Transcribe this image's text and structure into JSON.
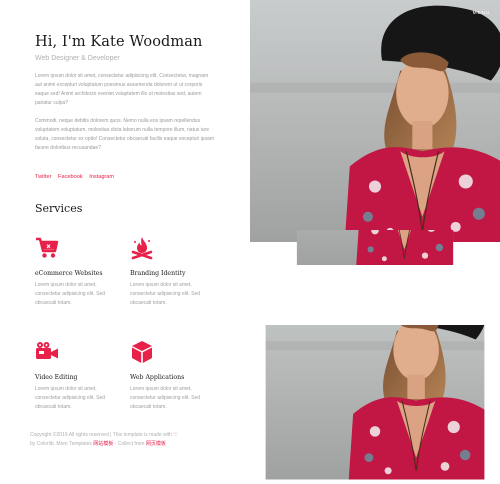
{
  "hero": {
    "title": "Hi, I'm Kate Woodman",
    "subtitle": "Web Designer & Developer"
  },
  "about": {
    "paragraph1": "Lorem ipsum dolor sit amet, consectetur adipisicing elit. Consectetur, magnam aut animi excepturi voluptatum possimus assumenda dolorem ut ut corporis eaque sed! Animi architecto eveniet voluptatem illo ut molestias sed, autem pariatur culpa?",
    "paragraph2": "Commodi, neque debitis dolorem quos. Nemo nulla eos ipsam repellendus voluptatem voluptatum, molestiae dicta laborum nulla tempore illum, natus iure soluta, consectetur ex optio! Consectetur obcaecati facilis eaque excepturi ipsam facere doloribus recusandae?"
  },
  "social": [
    "Twitter",
    "Facebook",
    "Instagram"
  ],
  "services": {
    "title": "Services",
    "items": [
      {
        "name": "eCommerce Websites",
        "description": "Lorem ipsum dolor sit amet, consectetur adipisicing elit. Sed obcaecati totam.",
        "icon": "cart-icon"
      },
      {
        "name": "Branding Identity",
        "description": "Lorem ipsum dolor sit amet, consectetur adipisicing elit. Sed obcaecati totam.",
        "icon": "fire-icon"
      },
      {
        "name": "Video Editing",
        "description": "Lorem ipsum dolor sit amet, consectetur adipisicing elit. Sed obcaecati totam.",
        "icon": "video-camera-icon"
      },
      {
        "name": "Web Applications",
        "description": "Lorem ipsum dolor sit amet, consectetur adipisicing elit. Sed obcaecati totam.",
        "icon": "cube-icon"
      }
    ]
  },
  "footer": {
    "line1_text": "Copyright ©2019 All rights reserved | This template is made with",
    "line1_symbol": "♡",
    "line2_prefix": "by Colorlib. More Templates",
    "link1": "网站模板",
    "line2_middle": " - Collect from ",
    "link2": "网页模板"
  },
  "menu": {
    "label": "MENU"
  },
  "colors": {
    "accent": "#e8214a"
  }
}
